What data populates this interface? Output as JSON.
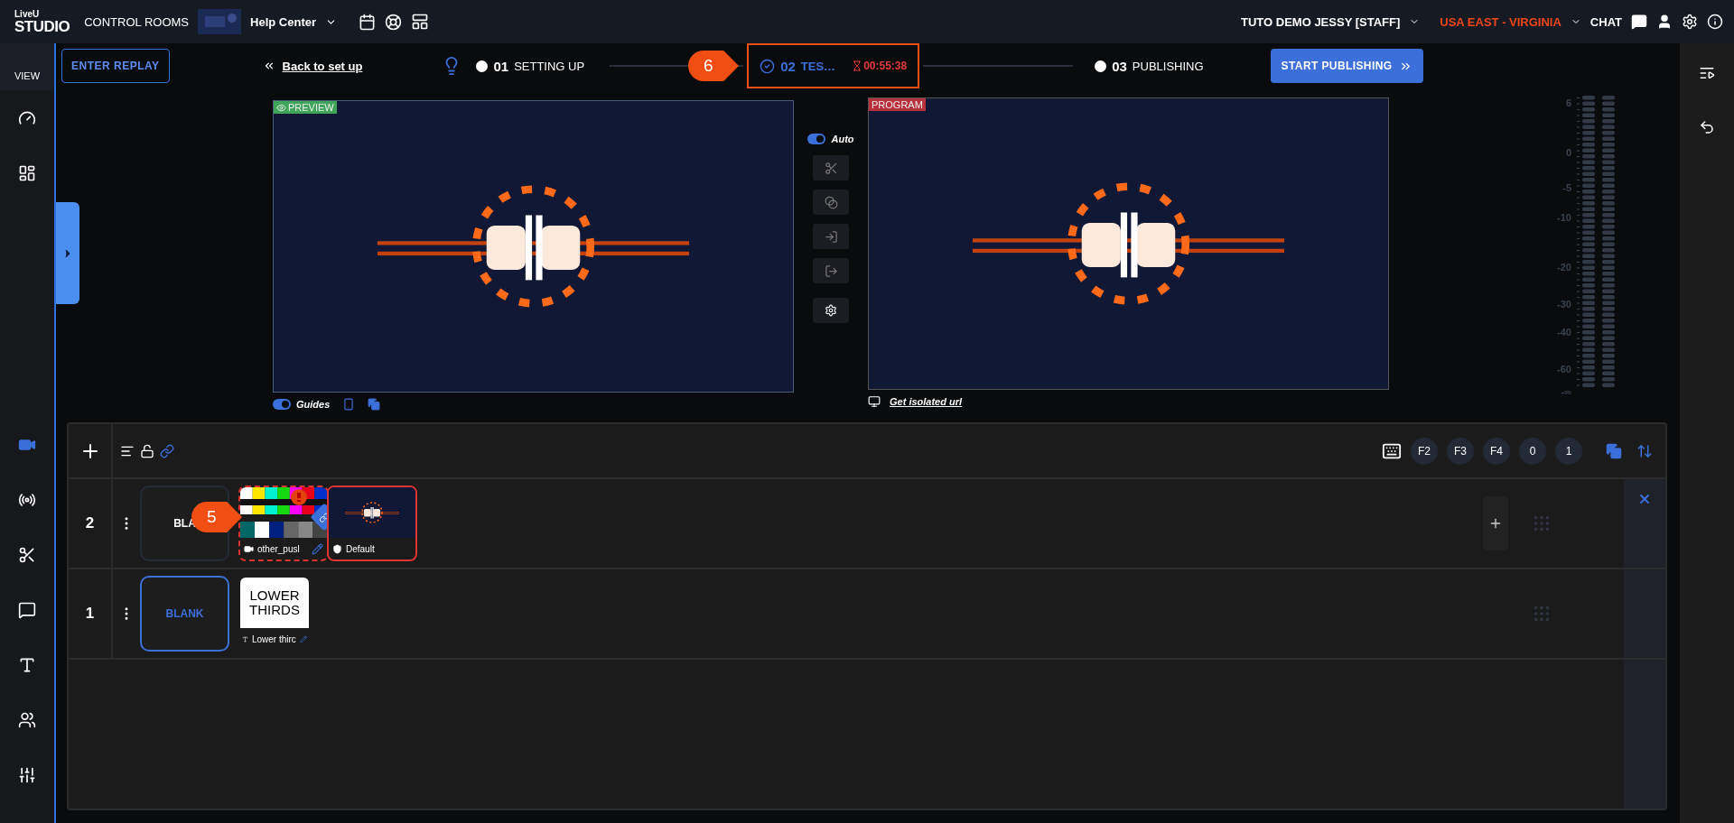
{
  "top_bar": {
    "logo": {
      "line_1": "LiveU",
      "line_2": "STUDIO"
    },
    "nav_link": "CONTROL ROOMS",
    "room": "Help Center",
    "user": "TUTO DEMO JESSY [STAFF]",
    "region": "USA EAST - VIRGINIA",
    "chat": "CHAT"
  },
  "sidebar": {
    "view_label": "VIEW",
    "items": [
      {
        "selected": false
      },
      {
        "selected": false
      },
      {
        "selected": true
      },
      {
        "selected": false
      },
      {
        "selected": false
      },
      {
        "selected": false
      },
      {
        "selected": false
      },
      {
        "selected": false
      },
      {
        "selected": false
      }
    ]
  },
  "step_bar": {
    "replay_button": "ENTER REPLAY",
    "back_link": "Back to set up",
    "publish_button": "START PUBLISHING",
    "steps": [
      {
        "number": "01",
        "label": "SETTING UP",
        "current": false
      },
      {
        "number": "02",
        "label": "TES…",
        "current": true,
        "timer": "00:55:38"
      },
      {
        "number": "03",
        "label": "PUBLISHING",
        "current": false
      }
    ]
  },
  "annotations": [
    {
      "number": "6"
    },
    {
      "number": "5"
    }
  ],
  "preview": {
    "label": "PREVIEW",
    "guides": {
      "label": "Guides",
      "on": true
    }
  },
  "transitions": {
    "auto": {
      "label": "Auto",
      "on": true
    }
  },
  "program": {
    "label": "PROGRAM",
    "isolated_link": "Get isolated url"
  },
  "audio_meter": {
    "scale": [
      "6",
      "0",
      "-5",
      "-10",
      "-20",
      "-30",
      "-40",
      "-60",
      "-∞"
    ]
  },
  "layers": {
    "hotkeys": [
      "F2",
      "F3",
      "F4",
      "0",
      "1"
    ],
    "rows": [
      {
        "number": "2",
        "blank": {
          "label": "BLA",
          "selected": false
        },
        "add_button": true,
        "closable": true,
        "sources": [
          {
            "kind": "video",
            "name": "other_pusl",
            "warning": true,
            "linked": true
          },
          {
            "kind": "overlay",
            "name": "Default"
          }
        ]
      },
      {
        "number": "1",
        "blank": {
          "label": "BLANK",
          "selected": true
        },
        "add_button": false,
        "closable": false,
        "sources": [
          {
            "kind": "graphic",
            "name": "Lower thirc",
            "thumbnail_text": "LOWER THIRDS"
          }
        ]
      }
    ]
  }
}
